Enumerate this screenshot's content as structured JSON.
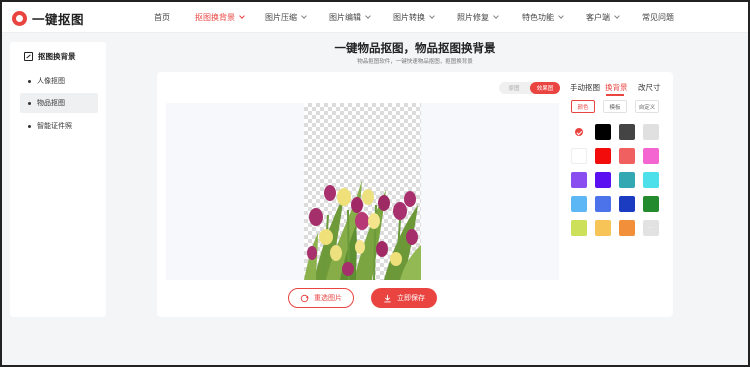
{
  "app": {
    "name": "一键抠图"
  },
  "nav": {
    "items": [
      {
        "label": "首页",
        "active": false,
        "dropdown": false
      },
      {
        "label": "抠图换背景",
        "active": true,
        "dropdown": true
      },
      {
        "label": "图片压缩",
        "active": false,
        "dropdown": true
      },
      {
        "label": "图片编辑",
        "active": false,
        "dropdown": true
      },
      {
        "label": "图片转换",
        "active": false,
        "dropdown": true
      },
      {
        "label": "照片修复",
        "active": false,
        "dropdown": true
      },
      {
        "label": "特色功能",
        "active": false,
        "dropdown": true
      },
      {
        "label": "客户端",
        "active": false,
        "dropdown": true
      },
      {
        "label": "常见问题",
        "active": false,
        "dropdown": false
      }
    ]
  },
  "sidebar": {
    "header": "抠图换背景",
    "items": [
      {
        "label": "人像抠图",
        "active": false
      },
      {
        "label": "物品抠图",
        "active": true
      },
      {
        "label": "智能证件照",
        "active": false
      }
    ]
  },
  "main": {
    "title": "一键物品抠图，物品抠图换背景",
    "subtitle": "物品抠图软件，一键快速物品抠图，抠图换背景"
  },
  "view_toggle": {
    "original": "原图",
    "result": "效果图",
    "selected": "result"
  },
  "tools": {
    "tabs": [
      {
        "label": "手动抠图",
        "active": false
      },
      {
        "label": "换背景",
        "active": true
      },
      {
        "label": "改尺寸",
        "active": false
      }
    ],
    "subtabs": [
      {
        "label": "颜色",
        "active": true
      },
      {
        "label": "模板",
        "active": false
      },
      {
        "label": "自定义",
        "active": false
      }
    ],
    "swatches": [
      "transparent",
      "#000000",
      "#444444",
      "#e0e0e0",
      "#ffffff",
      "#f20c0c",
      "#f16060",
      "#f565d2",
      "#8a4df0",
      "#5a10f0",
      "#34a8b2",
      "#4ee0ea",
      "#5db7f4",
      "#4c73ea",
      "#1b3cc0",
      "#238a2e",
      "#cce05a",
      "#f7c557",
      "#f28f3a",
      "more"
    ],
    "selected_swatch": "transparent"
  },
  "actions": {
    "reselect": "重选图片",
    "save": "立即保存"
  },
  "colors": {
    "accent": "#e94440"
  }
}
